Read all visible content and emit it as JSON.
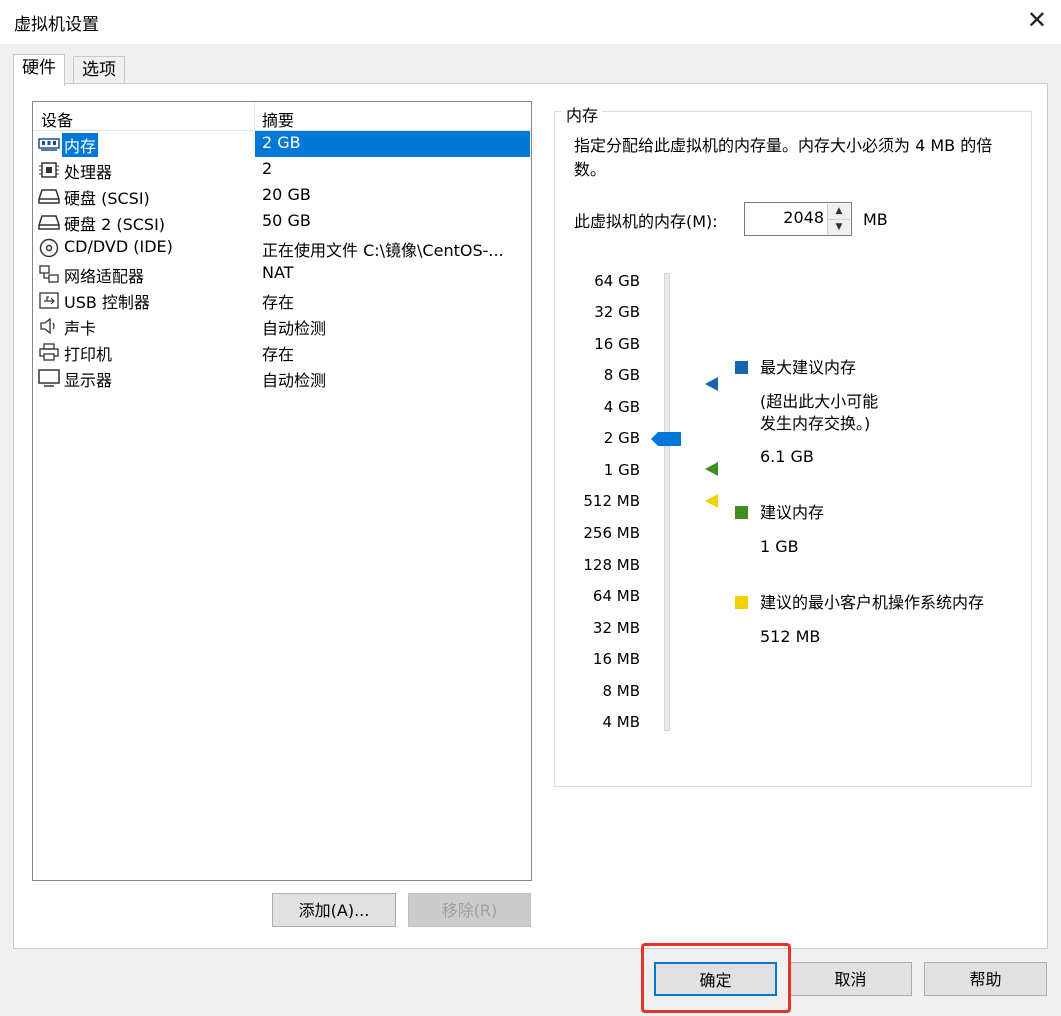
{
  "window": {
    "title": "虚拟机设置",
    "close_glyph": "✕"
  },
  "tabs": [
    {
      "label": "硬件",
      "active": true
    },
    {
      "label": "选项",
      "active": false
    }
  ],
  "device_table": {
    "headers": {
      "device": "设备",
      "summary": "摘要"
    },
    "rows": [
      {
        "icon": "memory-icon",
        "name": "内存",
        "summary": "2 GB",
        "selected": true
      },
      {
        "icon": "processor-icon",
        "name": "处理器",
        "summary": "2"
      },
      {
        "icon": "harddisk-icon",
        "name": "硬盘 (SCSI)",
        "summary": "20 GB"
      },
      {
        "icon": "harddisk-icon",
        "name": "硬盘 2 (SCSI)",
        "summary": "50 GB"
      },
      {
        "icon": "cd-dvd-icon",
        "name": "CD/DVD (IDE)",
        "summary": "正在使用文件 C:\\镜像\\CentOS-..."
      },
      {
        "icon": "network-adapter-icon",
        "name": "网络适配器",
        "summary": "NAT"
      },
      {
        "icon": "usb-icon",
        "name": "USB 控制器",
        "summary": "存在"
      },
      {
        "icon": "sound-card-icon",
        "name": "声卡",
        "summary": "自动检测"
      },
      {
        "icon": "printer-icon",
        "name": "打印机",
        "summary": "存在"
      },
      {
        "icon": "display-icon",
        "name": "显示器",
        "summary": "自动检测"
      }
    ]
  },
  "buttons": {
    "add": "添加(A)...",
    "remove": "移除(R)",
    "ok": "确定",
    "cancel": "取消",
    "help": "帮助"
  },
  "memory": {
    "group_label": "内存",
    "description": "指定分配给此虚拟机的内存量。内存大小必须为 4 MB 的倍数。",
    "field_label": "此虚拟机的内存(M):",
    "value": "2048",
    "unit": "MB",
    "current_level_label": "2 GB",
    "scale_ticks": [
      "64 GB",
      "32 GB",
      "16 GB",
      "8 GB",
      "4 GB",
      "2 GB",
      "1 GB",
      "512 MB",
      "256 MB",
      "128 MB",
      "64 MB",
      "32 MB",
      "16 MB",
      "8 MB",
      "4 MB"
    ],
    "legend": {
      "max": {
        "title": "最大建议内存",
        "note_line1": "(超出此大小可能",
        "note_line2": "发生内存交换。)",
        "value": "6.1 GB",
        "color": "#1565b0"
      },
      "recommended": {
        "title": "建议内存",
        "value": "1 GB",
        "color": "#3f8f1f"
      },
      "min_guest": {
        "title": "建议的最小客户机操作系统内存",
        "value": "512 MB",
        "color": "#f2d100"
      }
    },
    "thumb_color": "#0078d7"
  },
  "highlight_color": "#e8322c"
}
